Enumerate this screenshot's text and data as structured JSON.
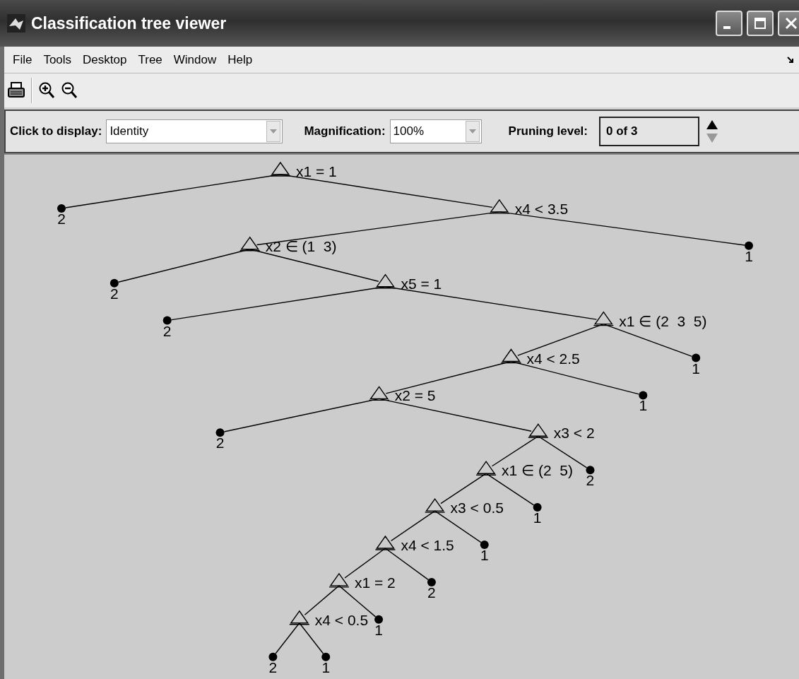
{
  "window": {
    "title": "Classification tree viewer"
  },
  "menu": [
    "File",
    "Tools",
    "Desktop",
    "Tree",
    "Window",
    "Help"
  ],
  "controls": {
    "display": {
      "label": "Click to display:",
      "value": "Identity"
    },
    "magnification": {
      "label": "Magnification:",
      "value": "100%"
    },
    "pruning": {
      "label": "Pruning level:",
      "value": "0 of 3"
    }
  },
  "tree": {
    "label": "x1 = 1",
    "children": [
      {
        "label": "2"
      },
      {
        "label": "x4 < 3.5",
        "children": [
          {
            "label": "x2 ∈ (1  3)",
            "children": [
              {
                "label": "2"
              },
              {
                "label": "x5 = 1",
                "children": [
                  {
                    "label": "2"
                  },
                  {
                    "label": "x1 ∈ (2  3  5)",
                    "children": [
                      {
                        "label": "x4 < 2.5",
                        "children": [
                          {
                            "label": "x2 = 5",
                            "children": [
                              {
                                "label": "2"
                              },
                              {
                                "label": "x3 < 2",
                                "children": [
                                  {
                                    "label": "x1 ∈ (2  5)",
                                    "children": [
                                      {
                                        "label": "x3 < 0.5",
                                        "children": [
                                          {
                                            "label": "x4 < 1.5",
                                            "children": [
                                              {
                                                "label": "x1 = 2",
                                                "children": [
                                                  {
                                                    "label": "x4 < 0.5",
                                                    "children": [
                                                      {
                                                        "label": "2"
                                                      },
                                                      {
                                                        "label": "1"
                                                      }
                                                    ]
                                                  },
                                                  {
                                                    "label": "1"
                                                  }
                                                ]
                                              },
                                              {
                                                "label": "2"
                                              }
                                            ]
                                          },
                                          {
                                            "label": "1"
                                          }
                                        ]
                                      },
                                      {
                                        "label": "1"
                                      }
                                    ]
                                  },
                                  {
                                    "label": "2"
                                  }
                                ]
                              }
                            ]
                          },
                          {
                            "label": "1"
                          }
                        ]
                      },
                      {
                        "label": "1"
                      }
                    ]
                  }
                ]
              }
            ]
          },
          {
            "label": "1"
          }
        ]
      }
    ]
  }
}
